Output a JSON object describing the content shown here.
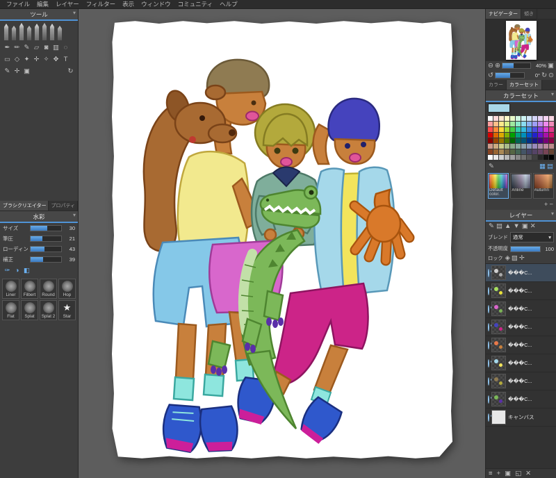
{
  "menubar": {
    "items": [
      "ファイル",
      "編集",
      "レイヤー",
      "フィルター",
      "表示",
      "ウィンドウ",
      "コミュニティ",
      "ヘルプ"
    ]
  },
  "ui_icons": {
    "caret_down": "▾",
    "star": "★"
  },
  "left_panel": {
    "tools_header": "ツール",
    "tool_icons_row1": [
      {
        "name": "pen-tool-icon",
        "glyph": "✒"
      },
      {
        "name": "pencil-tool-icon",
        "glyph": "✏"
      },
      {
        "name": "airbrush-tool-icon",
        "glyph": "✎"
      },
      {
        "name": "eraser-tool-icon",
        "glyph": "▱"
      },
      {
        "name": "bucket-tool-icon",
        "glyph": "◙"
      },
      {
        "name": "gradient-tool-icon",
        "glyph": "▥"
      },
      {
        "name": "blur-tool-icon",
        "glyph": "◌"
      }
    ],
    "tool_icons_row2": [
      {
        "name": "select-rect-tool-icon",
        "glyph": "▭"
      },
      {
        "name": "lasso-tool-icon",
        "glyph": "◇"
      },
      {
        "name": "magic-wand-tool-icon",
        "glyph": "✦"
      },
      {
        "name": "move-tool-icon",
        "glyph": "✛"
      },
      {
        "name": "eyedropper-tool-icon",
        "glyph": "✧"
      },
      {
        "name": "hand-tool-icon",
        "glyph": "✥"
      },
      {
        "name": "text-tool-icon",
        "glyph": "T"
      }
    ],
    "tool_icons_row3": [
      {
        "name": "edit-icon",
        "glyph": "✎"
      },
      {
        "name": "transform-icon",
        "glyph": "✛"
      },
      {
        "name": "selection-icon",
        "glyph": "▣"
      },
      {
        "name": "reset-view-icon",
        "glyph": "↻"
      }
    ],
    "brush_tabs": [
      {
        "label": "ブラシクリエイター"
      },
      {
        "label": "プロパティ"
      }
    ],
    "brush_header": "水彩",
    "sliders": [
      {
        "label": "サイズ",
        "value": "30",
        "fill": 55
      },
      {
        "label": "筆圧",
        "value": "21",
        "fill": 38
      },
      {
        "label": "ローディング",
        "value": "43",
        "fill": 46
      },
      {
        "label": "補正",
        "value": "39",
        "fill": 42
      }
    ],
    "brush_foot_icons": [
      {
        "name": "brush-option-size-icon",
        "glyph": "✑"
      },
      {
        "name": "brush-option-opacity-icon",
        "glyph": "◑"
      },
      {
        "name": "brush-option-mix-icon",
        "glyph": "◧"
      }
    ],
    "brush_presets": [
      {
        "label": "Liner",
        "icon": "round"
      },
      {
        "label": "Filbert",
        "icon": "round"
      },
      {
        "label": "Round",
        "icon": "round"
      },
      {
        "label": "Hop",
        "icon": "round"
      },
      {
        "label": "Flat",
        "icon": "round"
      },
      {
        "label": "Splat",
        "icon": "round"
      },
      {
        "label": "Splat 2",
        "icon": "round"
      },
      {
        "label": "Star",
        "icon": "star"
      }
    ]
  },
  "navigator": {
    "tabs": [
      {
        "label": "ナビゲーター"
      },
      {
        "label": "傾き"
      }
    ],
    "zoom_value": "40%",
    "zoom_fill": 40,
    "rotation_value": "0°",
    "rotation_fill": 50,
    "zoom_icons": [
      {
        "name": "zoom-out-icon",
        "glyph": "⊖"
      },
      {
        "name": "zoom-in-icon",
        "glyph": "⊕"
      }
    ],
    "fit_icons": [
      {
        "name": "fit-window-icon",
        "glyph": "▣"
      }
    ],
    "rotate_left_icons": [
      {
        "name": "rotate-left-icon",
        "glyph": "↺"
      }
    ],
    "rotate_right_icons": [
      {
        "name": "rotate-right-icon",
        "glyph": "↻"
      },
      {
        "name": "reset-rotation-icon",
        "glyph": "⊙"
      }
    ]
  },
  "color_panel": {
    "tabs": [
      {
        "label": "カラー"
      },
      {
        "label": "カラーセット"
      }
    ],
    "header": "カラーセット",
    "current_color": "#a9d7e8",
    "palette": [
      "#ffffff",
      "#ffd9d9",
      "#ffe8d0",
      "#fff9c8",
      "#e8f9c8",
      "#d0f5e0",
      "#ccf2f2",
      "#d0e4f7",
      "#d4d4f7",
      "#e6d4f5",
      "#f7d4f2",
      "#f7d4e0",
      "#ff9e9e",
      "#ffbe8a",
      "#ffe98a",
      "#d8f08a",
      "#9ee89e",
      "#8ae8c8",
      "#8adcf0",
      "#8ab4f0",
      "#9e9ef5",
      "#c08af0",
      "#ee8aee",
      "#f08ab8",
      "#ff4c4c",
      "#ff8a3a",
      "#ffd83a",
      "#aadd33",
      "#44cc44",
      "#33ccaa",
      "#33bbdd",
      "#3a86e0",
      "#4c4ce0",
      "#8a3ae0",
      "#d43ad4",
      "#e03a8a",
      "#d40000",
      "#dd6600",
      "#ddaa00",
      "#7fae00",
      "#00a000",
      "#00a080",
      "#0090bb",
      "#0055cc",
      "#2222cc",
      "#6a11cc",
      "#aa11aa",
      "#cc1166",
      "#8a0000",
      "#994400",
      "#997700",
      "#4c7700",
      "#006600",
      "#006655",
      "#005577",
      "#003388",
      "#151588",
      "#440088",
      "#770077",
      "#880044",
      "#cc9a8a",
      "#ccaa80",
      "#cccc8a",
      "#aabb8a",
      "#8aaa8a",
      "#8aaaa0",
      "#8aa0aa",
      "#8a99bb",
      "#9a8abb",
      "#aa8aaa",
      "#bb8aa0",
      "#bb8a8a",
      "#884422",
      "#996633",
      "#aa8855",
      "#776644",
      "#556644",
      "#446655",
      "#445566",
      "#444466",
      "#554466",
      "#664466",
      "#774455",
      "#664433",
      "#ffffff",
      "#e8e8e8",
      "#d0d0d0",
      "#b8b8b8",
      "#a0a0a0",
      "#888888",
      "#707070",
      "#585858",
      "#404040",
      "#282828",
      "#101010",
      "#000000"
    ],
    "tools_left": [
      {
        "name": "palette-edit-icon",
        "glyph": "✎"
      }
    ],
    "tools_right": [
      {
        "name": "palette-view-grid-icon",
        "glyph": "▦"
      },
      {
        "name": "palette-view-list-icon",
        "glyph": "▤"
      }
    ],
    "add_icons": [
      {
        "name": "palette-add-icon",
        "glyph": "+"
      },
      {
        "name": "palette-remove-icon",
        "glyph": "−"
      }
    ],
    "sets": [
      {
        "label": "Default color.",
        "selected": true
      },
      {
        "label": "Anline",
        "selected": false
      },
      {
        "label": "Autumn",
        "selected": false
      }
    ]
  },
  "layers_panel": {
    "header": "レイヤー",
    "toolbar_icons": [
      {
        "name": "layer-pen-icon",
        "glyph": "✎"
      },
      {
        "name": "layer-folder-icon",
        "glyph": "▤"
      },
      {
        "name": "layer-up-icon",
        "glyph": "▲"
      },
      {
        "name": "layer-down-icon",
        "glyph": "▼"
      },
      {
        "name": "layer-merge-icon",
        "glyph": "▣"
      },
      {
        "name": "layer-clear-icon",
        "glyph": "✕"
      }
    ],
    "blend_label": "ブレンド",
    "blend_value": "通常",
    "opacity_label": "不透明度",
    "opacity_value": "100",
    "opacity_fill": 100,
    "lock_label": "ロック",
    "lock_icons": [
      {
        "name": "lock-icon",
        "glyph": "◈"
      },
      {
        "name": "lock-alpha-icon",
        "glyph": "▨"
      },
      {
        "name": "lock-position-icon",
        "glyph": "✛"
      }
    ],
    "layers": [
      {
        "name": "���C...",
        "dots": [
          "#cfcfcf",
          "#aaaaaa"
        ]
      },
      {
        "name": "���C...",
        "dots": [
          "#a8e05f",
          "#e8e13a"
        ]
      },
      {
        "name": "���C...",
        "dots": [
          "#d966cc",
          "#7cb356"
        ]
      },
      {
        "name": "���C...",
        "dots": [
          "#4543bd",
          "#cc2488"
        ]
      },
      {
        "name": "���C...",
        "dots": [
          "#e8794a",
          "#c8803c"
        ]
      },
      {
        "name": "���C...",
        "dots": [
          "#a5d8ea",
          "#f2e45c"
        ]
      },
      {
        "name": "���C...",
        "dots": [
          "#8f7b52",
          "#b3a93c"
        ]
      },
      {
        "name": "���C...",
        "dots": [
          "#7cb859",
          "#5a2fa8"
        ]
      }
    ],
    "canvas_layer": {
      "name": "キャンバス"
    },
    "bottom_icons": [
      {
        "name": "layer-menu-icon",
        "glyph": "≡"
      },
      {
        "name": "layer-new-icon",
        "glyph": "+"
      },
      {
        "name": "layer-folder-new-icon",
        "glyph": "▣"
      },
      {
        "name": "layer-duplicate-icon",
        "glyph": "◱"
      },
      {
        "name": "layer-delete-icon",
        "glyph": "✕"
      }
    ]
  },
  "artwork": {
    "colors": {
      "skin": "#c8803c",
      "hand_orange": "#d9792a",
      "dog_brown": "#a86a32",
      "hair_left": "#8f7b52",
      "hair_center": "#b3a93c",
      "hair_right": "#4543bd",
      "shirt_yellow": "#f2e98e",
      "shorts_blue": "#85c8e8",
      "sweater_teal": "#7fae9b",
      "skirt_magenta": "#d867cc",
      "jacket_blue": "#a5d8ea",
      "inner_yellow": "#f2e45c",
      "pants_magenta": "#cc2488",
      "croc_green": "#7cb859",
      "claws_purple": "#5a2fa8",
      "shoe_blue": "#2f58cc",
      "shoe_magenta": "#cc1f9a",
      "sock_cyan": "#8ee6de"
    }
  }
}
